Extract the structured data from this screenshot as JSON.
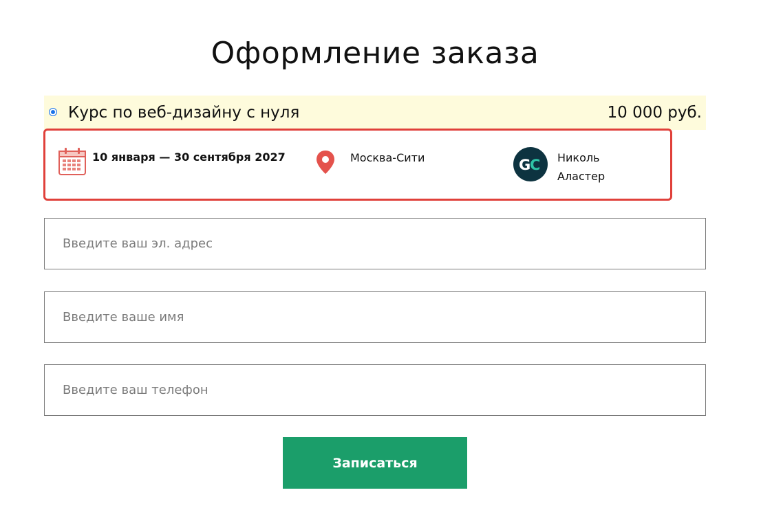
{
  "page": {
    "title": "Оформление заказа"
  },
  "product": {
    "name": "Курс по веб-дизайну с нуля",
    "price": "10 000 руб.",
    "selected": true
  },
  "details": {
    "dates": "10 января — 30 сентября 2027",
    "location": "Москва-Сити",
    "teacher_first": "Николь",
    "teacher_last": "Аластер",
    "avatar_initials": "GC"
  },
  "form": {
    "email_placeholder": "Введите ваш эл. адрес",
    "name_placeholder": "Введите ваше имя",
    "phone_placeholder": "Введите ваш телефон",
    "submit_label": "Записаться"
  },
  "colors": {
    "accent_green": "#1b9e6a",
    "highlight_red": "#e0403a",
    "product_row_bg": "#fefbdc",
    "avatar_bg": "#0d3340",
    "avatar_teal": "#2ec4a6"
  },
  "icons": {
    "calendar": "calendar-icon",
    "location": "location-pin-icon",
    "avatar": "avatar"
  }
}
